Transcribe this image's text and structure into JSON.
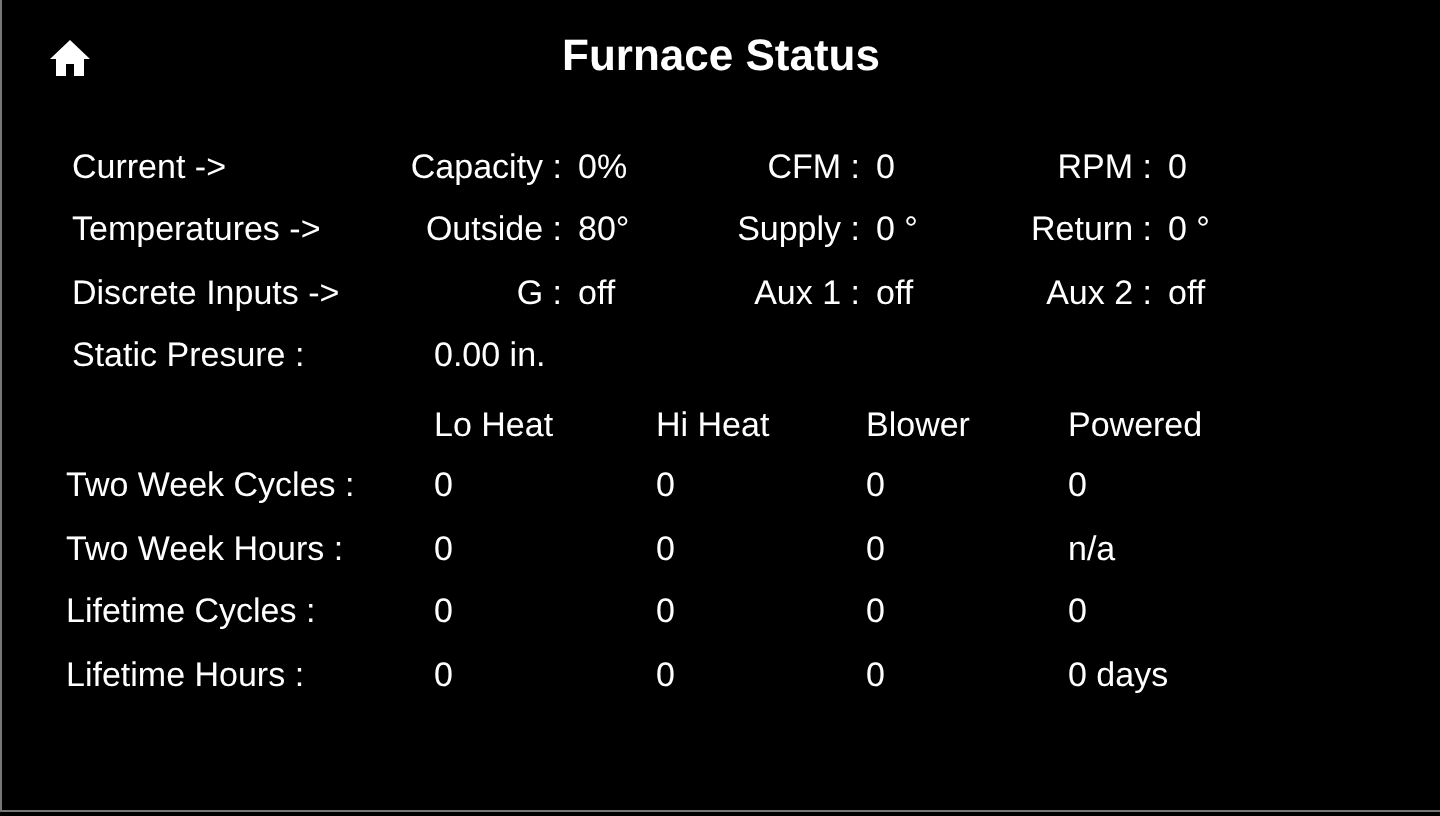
{
  "title": "Furnace Status",
  "status_rows": [
    {
      "label": "Current ->",
      "readings": [
        {
          "key": "Capacity :",
          "value": "0%"
        },
        {
          "key": "CFM :",
          "value": "0"
        },
        {
          "key": "RPM :",
          "value": "0"
        }
      ]
    },
    {
      "label": "Temperatures ->",
      "readings": [
        {
          "key": "Outside :",
          "value": "80°"
        },
        {
          "key": "Supply :",
          "value": "0 °"
        },
        {
          "key": "Return :",
          "value": "0 °"
        }
      ]
    },
    {
      "label": "Discrete Inputs ->",
      "readings": [
        {
          "key": "G :",
          "value": "off"
        },
        {
          "key": "Aux 1 :",
          "value": "off"
        },
        {
          "key": "Aux 2 :",
          "value": "off"
        }
      ]
    }
  ],
  "static_pressure": {
    "label": "Static Presure :",
    "value": "0.00 in."
  },
  "counters": {
    "columns": [
      "Lo Heat",
      "Hi Heat",
      "Blower",
      "Powered"
    ],
    "rows": [
      {
        "label": "Two Week Cycles :",
        "values": [
          "0",
          "0",
          "0",
          "0"
        ]
      },
      {
        "label": "Two Week Hours :",
        "values": [
          "0",
          "0",
          "0",
          "n/a"
        ]
      },
      {
        "label": "Lifetime Cycles :",
        "values": [
          "0",
          "0",
          "0",
          "0"
        ]
      },
      {
        "label": "Lifetime Hours :",
        "values": [
          "0",
          "0",
          "0",
          "0 days"
        ]
      }
    ]
  }
}
